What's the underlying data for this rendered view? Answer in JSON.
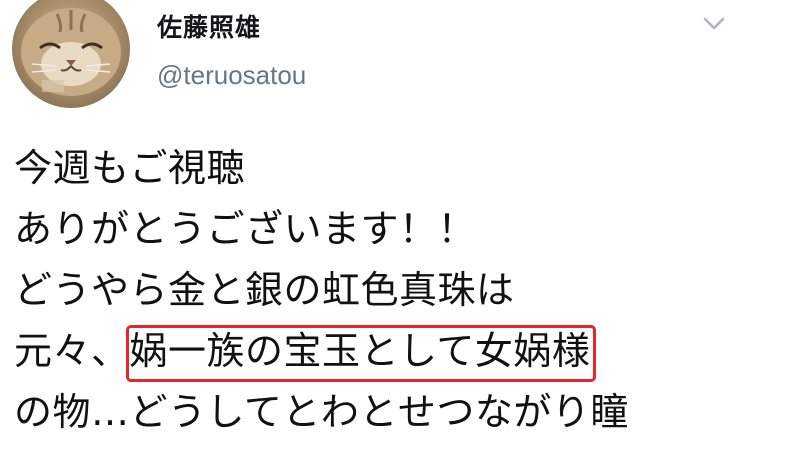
{
  "user": {
    "display_name": "佐藤照雄",
    "handle": "@teruosatou",
    "avatar_icon": "cat-avatar-icon"
  },
  "menu": {
    "icon": "chevron-down-icon"
  },
  "tweet": {
    "lines": [
      {
        "text": "今週もご視聴"
      },
      {
        "text": "ありがとうございます！！"
      },
      {
        "text": "どうやら金と銀の虹色真珠は"
      },
      {
        "before": "元々、",
        "highlighted": "娲一族の宝玉として女娲様"
      },
      {
        "text": "の物…どうしてとわとせつながり瞳"
      }
    ],
    "highlight_color": "#e5262d"
  }
}
